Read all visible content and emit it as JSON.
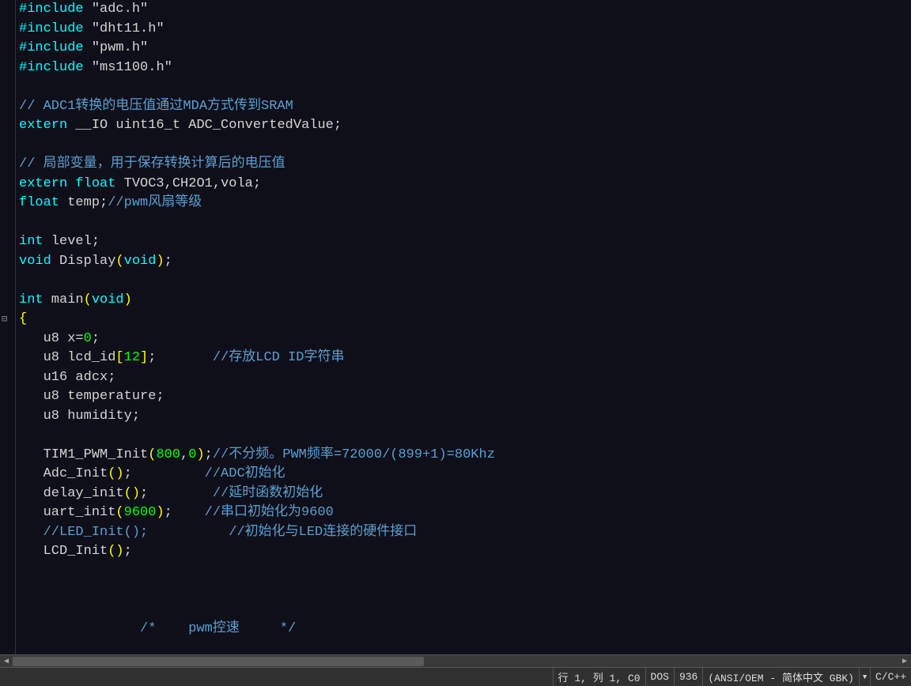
{
  "fold_marker_line": 17,
  "code_lines": [
    {
      "segments": [
        {
          "cls": "preprocessor",
          "t": "#include"
        },
        {
          "cls": "string",
          "t": " \"adc.h\""
        }
      ]
    },
    {
      "segments": [
        {
          "cls": "preprocessor",
          "t": "#include"
        },
        {
          "cls": "string",
          "t": " \"dht11.h\""
        }
      ]
    },
    {
      "segments": [
        {
          "cls": "preprocessor",
          "t": "#include"
        },
        {
          "cls": "string",
          "t": " \"pwm.h\""
        }
      ]
    },
    {
      "segments": [
        {
          "cls": "preprocessor",
          "t": "#include"
        },
        {
          "cls": "string",
          "t": " \"ms1100.h\""
        }
      ]
    },
    {
      "segments": [
        {
          "cls": "",
          "t": ""
        }
      ]
    },
    {
      "segments": [
        {
          "cls": "comment",
          "t": "// ADC1转换的电压值通过MDA方式传到SRAM"
        }
      ]
    },
    {
      "segments": [
        {
          "cls": "keyword",
          "t": "extern"
        },
        {
          "cls": "identifier",
          "t": " __IO uint16_t ADC_ConvertedValue"
        },
        {
          "cls": "punct",
          "t": ";"
        }
      ]
    },
    {
      "segments": [
        {
          "cls": "",
          "t": ""
        }
      ]
    },
    {
      "segments": [
        {
          "cls": "comment",
          "t": "// 局部变量，用于保存转换计算后的电压值"
        }
      ]
    },
    {
      "segments": [
        {
          "cls": "keyword",
          "t": "extern float"
        },
        {
          "cls": "identifier",
          "t": " TVOC3"
        },
        {
          "cls": "punct",
          "t": ","
        },
        {
          "cls": "identifier",
          "t": "CH2O1"
        },
        {
          "cls": "punct",
          "t": ","
        },
        {
          "cls": "identifier",
          "t": "vola"
        },
        {
          "cls": "punct",
          "t": ";"
        }
      ]
    },
    {
      "segments": [
        {
          "cls": "keyword",
          "t": "float"
        },
        {
          "cls": "identifier",
          "t": " temp"
        },
        {
          "cls": "punct",
          "t": ";"
        },
        {
          "cls": "comment",
          "t": "//pwm风扇等级"
        }
      ]
    },
    {
      "segments": [
        {
          "cls": "",
          "t": ""
        }
      ]
    },
    {
      "segments": [
        {
          "cls": "keyword",
          "t": "int"
        },
        {
          "cls": "identifier",
          "t": " level"
        },
        {
          "cls": "punct",
          "t": ";"
        }
      ]
    },
    {
      "segments": [
        {
          "cls": "keyword",
          "t": "void"
        },
        {
          "cls": "identifier",
          "t": " Display"
        },
        {
          "cls": "paren-yellow",
          "t": "("
        },
        {
          "cls": "keyword",
          "t": "void"
        },
        {
          "cls": "paren-yellow",
          "t": ")"
        },
        {
          "cls": "punct",
          "t": ";"
        }
      ]
    },
    {
      "segments": [
        {
          "cls": "",
          "t": ""
        }
      ]
    },
    {
      "segments": [
        {
          "cls": "keyword",
          "t": "int"
        },
        {
          "cls": "identifier",
          "t": " main"
        },
        {
          "cls": "paren-yellow",
          "t": "("
        },
        {
          "cls": "keyword",
          "t": "void"
        },
        {
          "cls": "paren-yellow",
          "t": ")"
        }
      ]
    },
    {
      "segments": [
        {
          "cls": "paren-yellow",
          "t": "{"
        }
      ]
    },
    {
      "segments": [
        {
          "cls": "identifier",
          "t": "   u8 x"
        },
        {
          "cls": "punct",
          "t": "="
        },
        {
          "cls": "number",
          "t": "0"
        },
        {
          "cls": "punct",
          "t": ";"
        }
      ]
    },
    {
      "segments": [
        {
          "cls": "identifier",
          "t": "   u8 lcd_id"
        },
        {
          "cls": "paren-yellow",
          "t": "["
        },
        {
          "cls": "number",
          "t": "12"
        },
        {
          "cls": "paren-yellow",
          "t": "]"
        },
        {
          "cls": "punct",
          "t": ";"
        },
        {
          "cls": "",
          "t": "       "
        },
        {
          "cls": "comment",
          "t": "//存放LCD ID字符串"
        }
      ]
    },
    {
      "segments": [
        {
          "cls": "identifier",
          "t": "   u16 adcx"
        },
        {
          "cls": "punct",
          "t": ";"
        }
      ]
    },
    {
      "segments": [
        {
          "cls": "identifier",
          "t": "   u8 temperature"
        },
        {
          "cls": "punct",
          "t": ";"
        }
      ]
    },
    {
      "segments": [
        {
          "cls": "identifier",
          "t": "   u8 humidity"
        },
        {
          "cls": "punct",
          "t": ";"
        }
      ]
    },
    {
      "segments": [
        {
          "cls": "",
          "t": ""
        }
      ]
    },
    {
      "segments": [
        {
          "cls": "identifier",
          "t": "   TIM1_PWM_Init"
        },
        {
          "cls": "paren-yellow",
          "t": "("
        },
        {
          "cls": "number",
          "t": "800"
        },
        {
          "cls": "punct",
          "t": ","
        },
        {
          "cls": "number",
          "t": "0"
        },
        {
          "cls": "paren-yellow",
          "t": ")"
        },
        {
          "cls": "punct",
          "t": ";"
        },
        {
          "cls": "comment",
          "t": "//不分频。PWM频率=72000/(899+1)=80Khz"
        }
      ]
    },
    {
      "segments": [
        {
          "cls": "identifier",
          "t": "   Adc_Init"
        },
        {
          "cls": "paren-yellow",
          "t": "()"
        },
        {
          "cls": "punct",
          "t": ";"
        },
        {
          "cls": "",
          "t": "         "
        },
        {
          "cls": "comment",
          "t": "//ADC初始化"
        }
      ]
    },
    {
      "segments": [
        {
          "cls": "identifier",
          "t": "   delay_init"
        },
        {
          "cls": "paren-yellow",
          "t": "()"
        },
        {
          "cls": "punct",
          "t": ";"
        },
        {
          "cls": "",
          "t": "        "
        },
        {
          "cls": "comment",
          "t": "//延时函数初始化"
        }
      ]
    },
    {
      "segments": [
        {
          "cls": "identifier",
          "t": "   uart_init"
        },
        {
          "cls": "paren-yellow",
          "t": "("
        },
        {
          "cls": "number",
          "t": "9600"
        },
        {
          "cls": "paren-yellow",
          "t": ")"
        },
        {
          "cls": "punct",
          "t": ";"
        },
        {
          "cls": "",
          "t": "    "
        },
        {
          "cls": "comment",
          "t": "//串口初始化为9600"
        }
      ]
    },
    {
      "segments": [
        {
          "cls": "comment",
          "t": "   //LED_Init();          //初始化与LED连接的硬件接口"
        }
      ]
    },
    {
      "segments": [
        {
          "cls": "identifier",
          "t": "   LCD_Init"
        },
        {
          "cls": "paren-yellow",
          "t": "()"
        },
        {
          "cls": "punct",
          "t": ";"
        }
      ]
    },
    {
      "segments": [
        {
          "cls": "",
          "t": ""
        }
      ]
    },
    {
      "segments": [
        {
          "cls": "",
          "t": ""
        }
      ]
    },
    {
      "segments": [
        {
          "cls": "",
          "t": ""
        }
      ]
    },
    {
      "segments": [
        {
          "cls": "comment",
          "t": "               /*    pwm控速     */"
        }
      ]
    }
  ],
  "status": {
    "position": "行 1, 列 1, C0",
    "lineending": "DOS",
    "codepage": "936",
    "encoding": "(ANSI/OEM - 简体中文 GBK)",
    "language": "C/C++"
  },
  "icons": {
    "fold": "⊟",
    "dropdown": "▾",
    "scroll_left": "◀",
    "scroll_right": "▶"
  }
}
